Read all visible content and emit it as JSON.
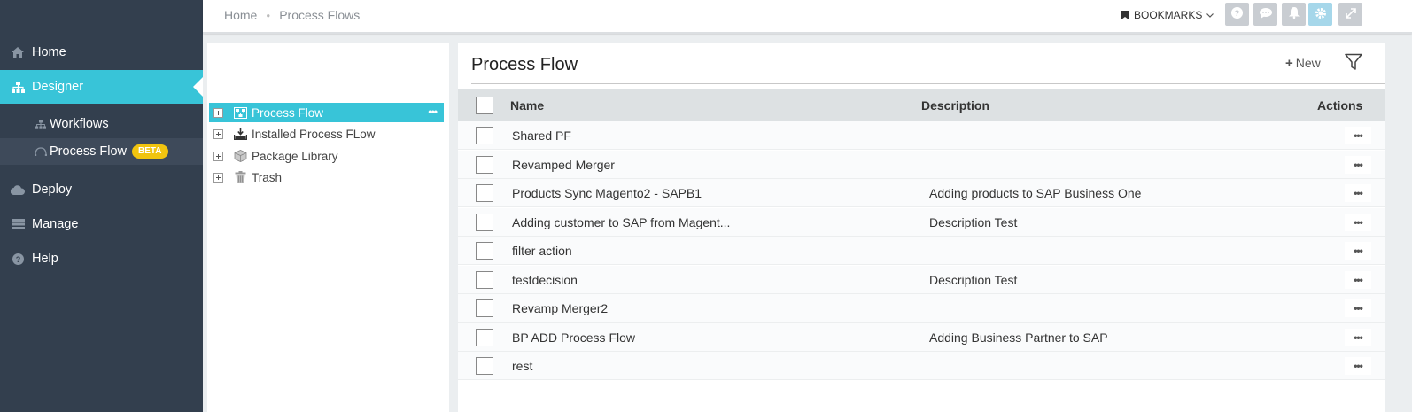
{
  "sidebar": {
    "items": [
      {
        "label": "Home",
        "icon": "home-icon"
      },
      {
        "label": "Designer",
        "icon": "sitemap-icon",
        "active": true
      },
      {
        "label": "Deploy",
        "icon": "cloud-icon"
      },
      {
        "label": "Manage",
        "icon": "server-icon"
      },
      {
        "label": "Help",
        "icon": "question-icon"
      }
    ],
    "subitems": [
      {
        "label": "Workflows",
        "icon": "sitemap-small-icon"
      },
      {
        "label": "Process Flow",
        "icon": "process-flow-icon",
        "badge": "BETA",
        "active": true
      }
    ]
  },
  "topbar": {
    "breadcrumb": [
      "Home",
      "Process Flows"
    ],
    "bookmarks_label": "BOOKMARKS",
    "buttons": [
      "help-icon",
      "chat-icon",
      "bell-icon",
      "gear-icon",
      "expand-icon"
    ]
  },
  "tree": {
    "items": [
      {
        "label": "Process Flow",
        "icon": "process-flow-tree-icon",
        "selected": true
      },
      {
        "label": "Installed Process FLow",
        "icon": "install-icon"
      },
      {
        "label": "Package Library",
        "icon": "package-icon"
      },
      {
        "label": "Trash",
        "icon": "trash-icon"
      }
    ]
  },
  "main": {
    "title": "Process Flow",
    "new_label": "New",
    "columns": [
      "Name",
      "Description",
      "Actions"
    ],
    "rows": [
      {
        "name": "Shared PF",
        "description": ""
      },
      {
        "name": "Revamped Merger",
        "description": ""
      },
      {
        "name": "Products Sync Magento2 - SAPB1",
        "description": "Adding products to SAP Business One"
      },
      {
        "name": "Adding customer to SAP from Magent...",
        "description": "Description Test"
      },
      {
        "name": "filter action",
        "description": ""
      },
      {
        "name": "testdecision",
        "description": "Description Test"
      },
      {
        "name": "Revamp Merger2",
        "description": ""
      },
      {
        "name": "BP ADD Process Flow",
        "description": "Adding Business Partner to SAP"
      },
      {
        "name": "rest",
        "description": ""
      }
    ]
  },
  "colors": {
    "sidebar_bg": "#333f4e",
    "accent": "#38c4d8",
    "badge": "#f1c40f",
    "table_header_bg": "#dde1e3"
  }
}
